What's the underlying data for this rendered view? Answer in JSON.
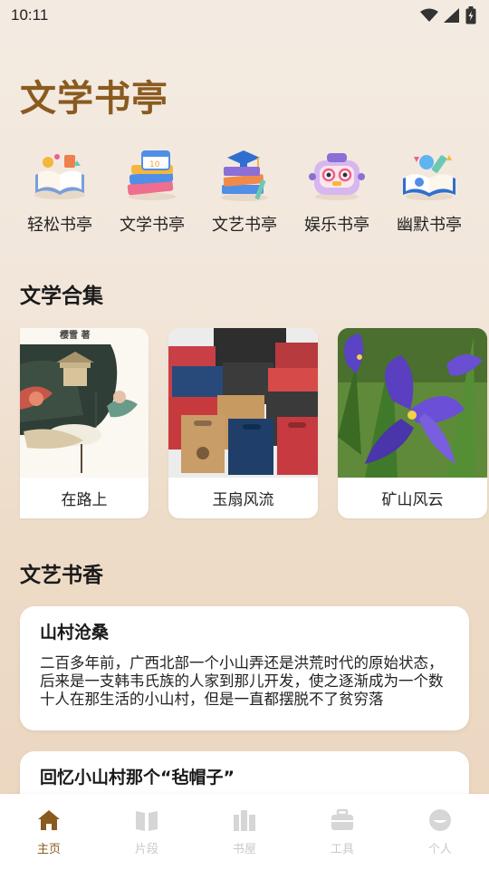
{
  "status_bar": {
    "time": "10:11",
    "icons": [
      "wifi-icon",
      "signal-icon",
      "battery-icon"
    ]
  },
  "app": {
    "title": "文学书亭",
    "accent_color": "#8a5a1f"
  },
  "categories": [
    {
      "label": "轻松书亭",
      "icon": "open-book-icon"
    },
    {
      "label": "文学书亭",
      "icon": "calendar-books-icon"
    },
    {
      "label": "文艺书亭",
      "icon": "graduation-books-icon"
    },
    {
      "label": "娱乐书亭",
      "icon": "robot-icon"
    },
    {
      "label": "幽默书亭",
      "icon": "science-book-icon"
    }
  ],
  "collections": {
    "title": "文学合集",
    "items": [
      {
        "label": "在路上",
        "cover_text": "樱雪 著"
      },
      {
        "label": "玉扇风流"
      },
      {
        "label": "矿山风云"
      }
    ]
  },
  "articles": {
    "title": "文艺书香",
    "items": [
      {
        "title": "山村沧桑",
        "body": "二百多年前，广西北部一个小山弄还是洪荒时代的原始状态，后来是一支韩韦氏族的人家到那儿开发，使之逐渐成为一个数十人在那生活的小山村，但是一直都摆脱不了贫穷落"
      },
      {
        "title": "回忆小山村那个“毡帽子”",
        "body": ""
      }
    ]
  },
  "bottom_nav": [
    {
      "label": "主页",
      "icon": "home-icon",
      "active": true
    },
    {
      "label": "片段",
      "icon": "book-icon",
      "active": false
    },
    {
      "label": "书屋",
      "icon": "bookshelf-icon",
      "active": false
    },
    {
      "label": "工具",
      "icon": "briefcase-icon",
      "active": false
    },
    {
      "label": "个人",
      "icon": "person-icon",
      "active": false
    }
  ]
}
